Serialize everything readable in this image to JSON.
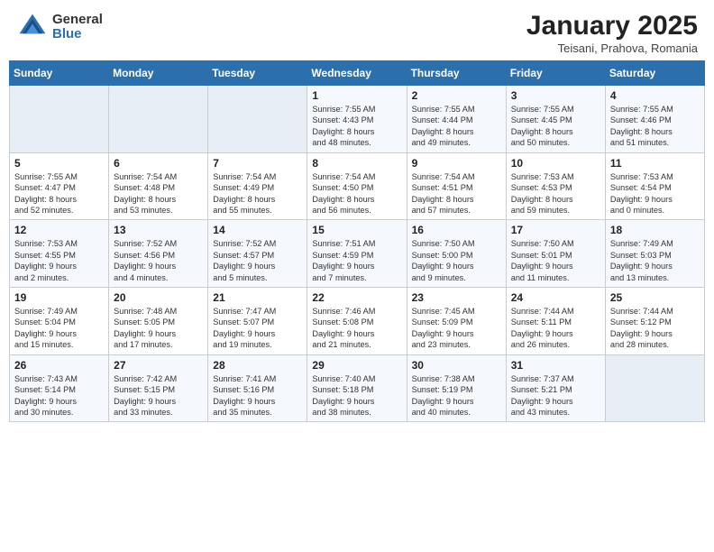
{
  "header": {
    "logo_general": "General",
    "logo_blue": "Blue",
    "title": "January 2025",
    "subtitle": "Teisani, Prahova, Romania"
  },
  "days_of_week": [
    "Sunday",
    "Monday",
    "Tuesday",
    "Wednesday",
    "Thursday",
    "Friday",
    "Saturday"
  ],
  "weeks": [
    [
      {
        "day": "",
        "info": ""
      },
      {
        "day": "",
        "info": ""
      },
      {
        "day": "",
        "info": ""
      },
      {
        "day": "1",
        "info": "Sunrise: 7:55 AM\nSunset: 4:43 PM\nDaylight: 8 hours\nand 48 minutes."
      },
      {
        "day": "2",
        "info": "Sunrise: 7:55 AM\nSunset: 4:44 PM\nDaylight: 8 hours\nand 49 minutes."
      },
      {
        "day": "3",
        "info": "Sunrise: 7:55 AM\nSunset: 4:45 PM\nDaylight: 8 hours\nand 50 minutes."
      },
      {
        "day": "4",
        "info": "Sunrise: 7:55 AM\nSunset: 4:46 PM\nDaylight: 8 hours\nand 51 minutes."
      }
    ],
    [
      {
        "day": "5",
        "info": "Sunrise: 7:55 AM\nSunset: 4:47 PM\nDaylight: 8 hours\nand 52 minutes."
      },
      {
        "day": "6",
        "info": "Sunrise: 7:54 AM\nSunset: 4:48 PM\nDaylight: 8 hours\nand 53 minutes."
      },
      {
        "day": "7",
        "info": "Sunrise: 7:54 AM\nSunset: 4:49 PM\nDaylight: 8 hours\nand 55 minutes."
      },
      {
        "day": "8",
        "info": "Sunrise: 7:54 AM\nSunset: 4:50 PM\nDaylight: 8 hours\nand 56 minutes."
      },
      {
        "day": "9",
        "info": "Sunrise: 7:54 AM\nSunset: 4:51 PM\nDaylight: 8 hours\nand 57 minutes."
      },
      {
        "day": "10",
        "info": "Sunrise: 7:53 AM\nSunset: 4:53 PM\nDaylight: 8 hours\nand 59 minutes."
      },
      {
        "day": "11",
        "info": "Sunrise: 7:53 AM\nSunset: 4:54 PM\nDaylight: 9 hours\nand 0 minutes."
      }
    ],
    [
      {
        "day": "12",
        "info": "Sunrise: 7:53 AM\nSunset: 4:55 PM\nDaylight: 9 hours\nand 2 minutes."
      },
      {
        "day": "13",
        "info": "Sunrise: 7:52 AM\nSunset: 4:56 PM\nDaylight: 9 hours\nand 4 minutes."
      },
      {
        "day": "14",
        "info": "Sunrise: 7:52 AM\nSunset: 4:57 PM\nDaylight: 9 hours\nand 5 minutes."
      },
      {
        "day": "15",
        "info": "Sunrise: 7:51 AM\nSunset: 4:59 PM\nDaylight: 9 hours\nand 7 minutes."
      },
      {
        "day": "16",
        "info": "Sunrise: 7:50 AM\nSunset: 5:00 PM\nDaylight: 9 hours\nand 9 minutes."
      },
      {
        "day": "17",
        "info": "Sunrise: 7:50 AM\nSunset: 5:01 PM\nDaylight: 9 hours\nand 11 minutes."
      },
      {
        "day": "18",
        "info": "Sunrise: 7:49 AM\nSunset: 5:03 PM\nDaylight: 9 hours\nand 13 minutes."
      }
    ],
    [
      {
        "day": "19",
        "info": "Sunrise: 7:49 AM\nSunset: 5:04 PM\nDaylight: 9 hours\nand 15 minutes."
      },
      {
        "day": "20",
        "info": "Sunrise: 7:48 AM\nSunset: 5:05 PM\nDaylight: 9 hours\nand 17 minutes."
      },
      {
        "day": "21",
        "info": "Sunrise: 7:47 AM\nSunset: 5:07 PM\nDaylight: 9 hours\nand 19 minutes."
      },
      {
        "day": "22",
        "info": "Sunrise: 7:46 AM\nSunset: 5:08 PM\nDaylight: 9 hours\nand 21 minutes."
      },
      {
        "day": "23",
        "info": "Sunrise: 7:45 AM\nSunset: 5:09 PM\nDaylight: 9 hours\nand 23 minutes."
      },
      {
        "day": "24",
        "info": "Sunrise: 7:44 AM\nSunset: 5:11 PM\nDaylight: 9 hours\nand 26 minutes."
      },
      {
        "day": "25",
        "info": "Sunrise: 7:44 AM\nSunset: 5:12 PM\nDaylight: 9 hours\nand 28 minutes."
      }
    ],
    [
      {
        "day": "26",
        "info": "Sunrise: 7:43 AM\nSunset: 5:14 PM\nDaylight: 9 hours\nand 30 minutes."
      },
      {
        "day": "27",
        "info": "Sunrise: 7:42 AM\nSunset: 5:15 PM\nDaylight: 9 hours\nand 33 minutes."
      },
      {
        "day": "28",
        "info": "Sunrise: 7:41 AM\nSunset: 5:16 PM\nDaylight: 9 hours\nand 35 minutes."
      },
      {
        "day": "29",
        "info": "Sunrise: 7:40 AM\nSunset: 5:18 PM\nDaylight: 9 hours\nand 38 minutes."
      },
      {
        "day": "30",
        "info": "Sunrise: 7:38 AM\nSunset: 5:19 PM\nDaylight: 9 hours\nand 40 minutes."
      },
      {
        "day": "31",
        "info": "Sunrise: 7:37 AM\nSunset: 5:21 PM\nDaylight: 9 hours\nand 43 minutes."
      },
      {
        "day": "",
        "info": ""
      }
    ]
  ]
}
